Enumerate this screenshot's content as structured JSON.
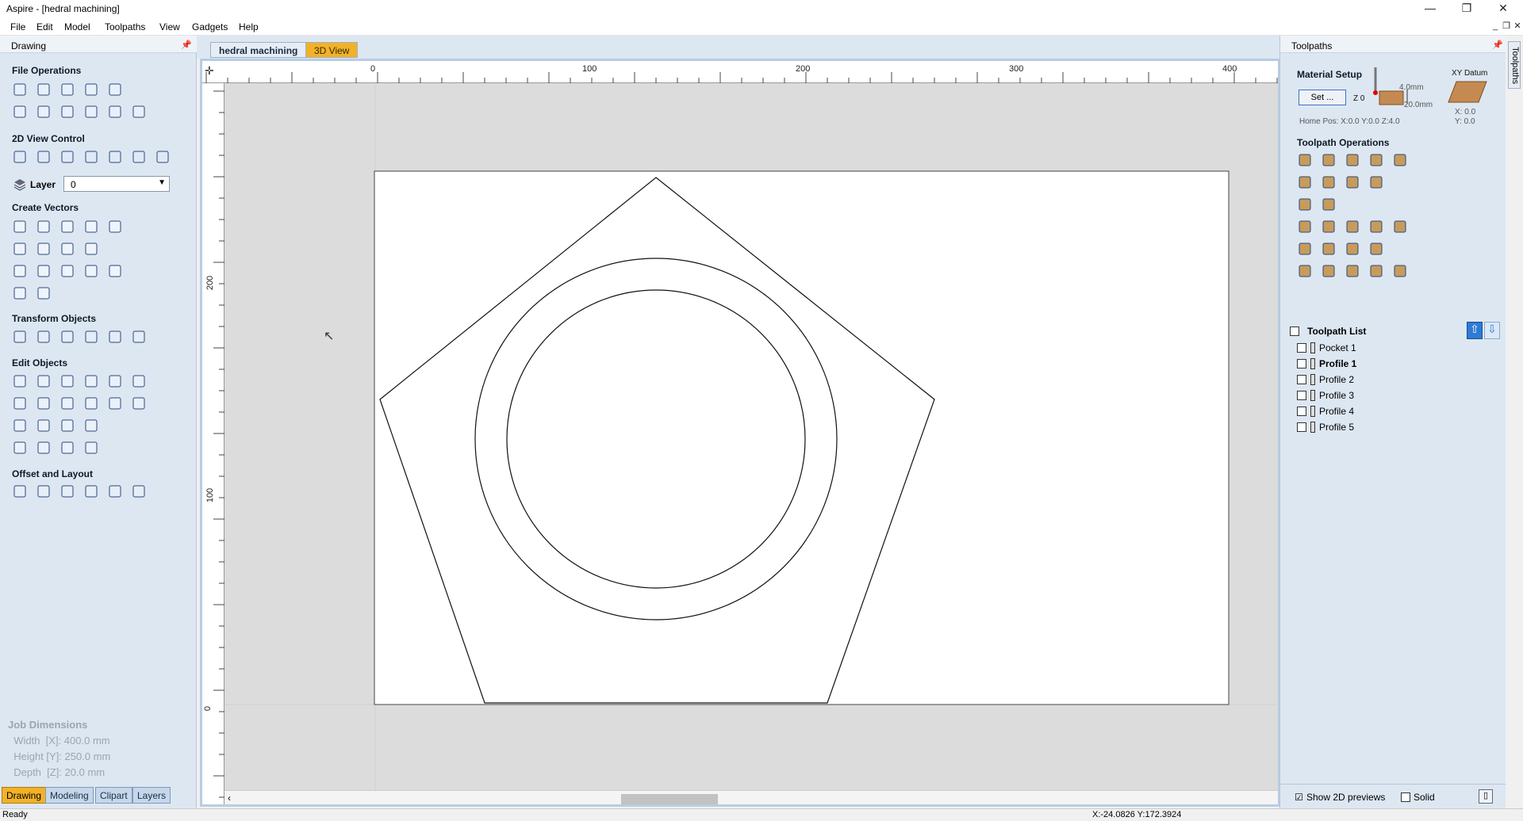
{
  "window": {
    "title": "Aspire - [hedral machining]",
    "minimize": "—",
    "restore": "❐",
    "close": "✕"
  },
  "menu": [
    "File",
    "Edit",
    "Model",
    "Toolpaths",
    "View",
    "Gadgets",
    "Help"
  ],
  "left_panel": {
    "title": "Drawing",
    "sections": {
      "file_ops": "File Operations",
      "view_control": "2D View Control",
      "layer_label": "Layer",
      "layer_value": "0",
      "create_vectors": "Create Vectors",
      "transform": "Transform Objects",
      "edit_objects": "Edit Objects",
      "offset_layout": "Offset and Layout"
    },
    "job_dimensions": {
      "title": "Job Dimensions",
      "width": "  Width  [X]: 400.0 mm",
      "height": "  Height [Y]: 250.0 mm",
      "depth": "  Depth  [Z]: 20.0 mm"
    },
    "tabs": [
      "Drawing",
      "Modeling",
      "Clipart",
      "Layers"
    ]
  },
  "doc_tabs": [
    "hedral machining",
    "3D View"
  ],
  "rulers": {
    "h_labels": [
      "0",
      "100",
      "200",
      "300",
      "400"
    ],
    "v_labels": [
      "200",
      "100",
      "0"
    ]
  },
  "right_panel": {
    "title": "Toolpaths",
    "side_tab": "Toolpaths",
    "material_setup": "Material Setup",
    "set_button": "Set ...",
    "z0": "Z 0",
    "thickness_top": "4.0mm",
    "thickness": "20.0mm",
    "xy_datum": "XY Datum",
    "datum_x": "X: 0.0",
    "datum_y": "Y: 0.0",
    "home_pos": "Home Pos:  X:0.0 Y:0.0 Z:4.0",
    "toolpath_ops": "Toolpath Operations",
    "toolpath_list_title": "Toolpath List",
    "toolpaths": [
      "Pocket 1",
      "Profile 1",
      "Profile 2",
      "Profile 3",
      "Profile 4",
      "Profile 5"
    ],
    "show_2d": "Show 2D previews",
    "solid": "Solid"
  },
  "status": {
    "left": "Ready",
    "coords": "X:-24.0826 Y:172.3924"
  }
}
